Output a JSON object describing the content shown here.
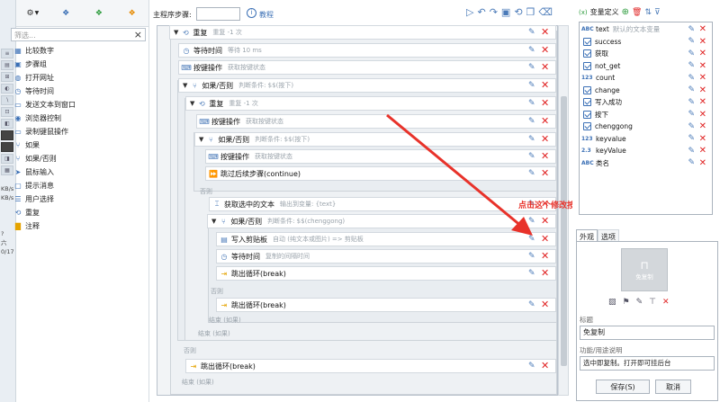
{
  "strip": {
    "texts": [
      "KB/s",
      "KB/s",
      "?",
      "六",
      "0/17"
    ]
  },
  "left": {
    "search_placeholder": "筛选...",
    "items": [
      {
        "label": "比较数字",
        "icon": "grid-icon"
      },
      {
        "label": "步骤组",
        "icon": "group-icon"
      },
      {
        "label": "打开网址",
        "icon": "globe-icon"
      },
      {
        "label": "等待时间",
        "icon": "clock-icon"
      },
      {
        "label": "发送文本到窗口",
        "icon": "window-icon"
      },
      {
        "label": "浏览器控制",
        "icon": "browser-icon"
      },
      {
        "label": "录制键鼠操作",
        "icon": "record-icon"
      },
      {
        "label": "如果",
        "icon": "branch-icon"
      },
      {
        "label": "如果/否则",
        "icon": "branch-icon"
      },
      {
        "label": "鼠标输入",
        "icon": "cursor-icon"
      },
      {
        "label": "提示消息",
        "icon": "message-icon"
      },
      {
        "label": "用户选择",
        "icon": "list-icon"
      },
      {
        "label": "重复",
        "icon": "repeat-icon"
      },
      {
        "label": "注释",
        "icon": "note-icon"
      }
    ]
  },
  "toolbar": {
    "main_steps_label": "主程序步骤:",
    "tutorial_label": "教程"
  },
  "canvas": {
    "r1": {
      "name": "重复",
      "sub": "重复 -1 次"
    },
    "r2": {
      "name": "等待时间",
      "sub": "等待 10 ms"
    },
    "r3": {
      "name": "按键操作",
      "sub": "获取按键状态"
    },
    "r4": {
      "name": "如果/否则",
      "sub": "判断条件: $$(按下)"
    },
    "r5": {
      "name": "重复",
      "sub": "重复 -1 次"
    },
    "r6": {
      "name": "按键操作",
      "sub": "获取按键状态"
    },
    "r7": {
      "name": "如果/否则",
      "sub": "判断条件: $$(按下)"
    },
    "r8": {
      "name": "按键操作",
      "sub": "获取按键状态"
    },
    "r9": {
      "name": "跳过后续步骤(continue)",
      "sub": ""
    },
    "else1": "否则",
    "r10": {
      "name": "获取选中的文本",
      "sub": "输出到变量: {text}"
    },
    "r11": {
      "name": "如果/否则",
      "sub": "判断条件: $$(chenggong)"
    },
    "r12": {
      "name": "写入剪贴板",
      "sub": "自动 (纯文本或图片) => 剪贴板"
    },
    "r13": {
      "name": "等待时间",
      "sub": "复制的间隔时间"
    },
    "r14": {
      "name": "跳出循环(break)",
      "sub": ""
    },
    "else2": "否则",
    "r15": {
      "name": "跳出循环(break)",
      "sub": ""
    },
    "end1": "结束 (如果)",
    "end2": "结束 (如果)",
    "else3": "否则",
    "r16": {
      "name": "跳出循环(break)",
      "sub": ""
    },
    "end3": "结束 (如果)"
  },
  "annotation": "点击这个修改按钮",
  "right": {
    "title": "变量定义",
    "vars": [
      {
        "type": "ABC",
        "name": "text",
        "hint": "默认的文本变量"
      },
      {
        "type": "chk",
        "name": "success",
        "hint": ""
      },
      {
        "type": "chk",
        "name": "获取",
        "hint": ""
      },
      {
        "type": "chk",
        "name": "not_get",
        "hint": ""
      },
      {
        "type": "123",
        "name": "count",
        "hint": ""
      },
      {
        "type": "chk",
        "name": "change",
        "hint": ""
      },
      {
        "type": "chk",
        "name": "写入成功",
        "hint": ""
      },
      {
        "type": "chk",
        "name": "按下",
        "hint": ""
      },
      {
        "type": "chk",
        "name": "chenggong",
        "hint": ""
      },
      {
        "type": "123",
        "name": "keyvalue",
        "hint": ""
      },
      {
        "type": "2.3",
        "name": "keyValue",
        "hint": ""
      },
      {
        "type": "ABC",
        "name": "类名",
        "hint": ""
      }
    ],
    "tab_appearance": "外观",
    "tab_options": "选项",
    "preview_caption": "免复制",
    "title_label": "标题",
    "title_value": "免复制",
    "desc_label": "功能/用途说明",
    "desc_value": "选中即复制。打开即可挂后台",
    "save": "保存(S)",
    "cancel": "取消"
  },
  "colors": {
    "accent": "#3a6fb5",
    "delete": "#e02424",
    "arrow": "#e8322a"
  }
}
